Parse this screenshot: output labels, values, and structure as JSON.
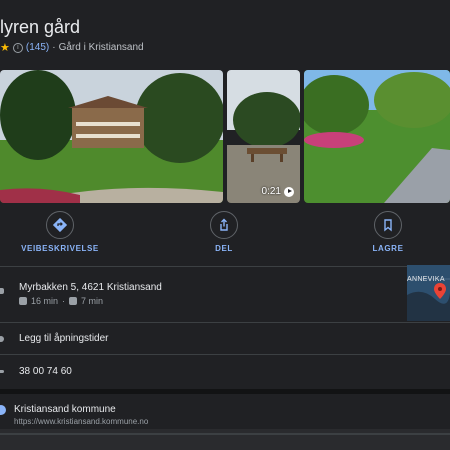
{
  "place": {
    "title": "lyren gård",
    "rating_star": "★",
    "info_glyph": "i",
    "reviews": "(145)",
    "separator": "·",
    "category": "Gård i Kristiansand"
  },
  "photos": {
    "video_duration": "0:21"
  },
  "actions": [
    {
      "label": "VEIBESKRIVELSE",
      "icon": "directions-icon"
    },
    {
      "label": "DEL",
      "icon": "share-icon"
    },
    {
      "label": "LAGRE",
      "icon": "bookmark-icon"
    }
  ],
  "details": {
    "address": "Myrbakken 5, 4621 Kristiansand",
    "transit_time": "16 min",
    "drive_time": "7 min",
    "map_label": "ANNEVIKA",
    "hours": "Legg til åpningstider",
    "phone": "38 00 74 60",
    "website_name": "Kristiansand kommune",
    "website_url": "https://www.kristiansand.kommune.no"
  },
  "colors": {
    "background": "#202124",
    "accent": "#8ab4f8",
    "star": "#fbbc04",
    "map_pin": "#ea4335"
  }
}
